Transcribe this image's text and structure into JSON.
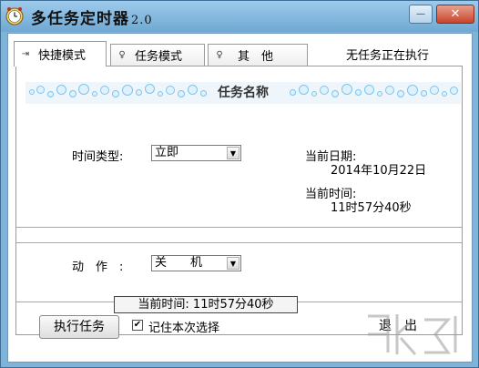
{
  "window": {
    "title": "多任务定时器",
    "version": "2.0",
    "minimize_glyph": "—",
    "close_glyph": "✕"
  },
  "tabs": [
    {
      "label": "快捷模式",
      "icon": "tab-icon-arrow",
      "glyph": "⇥",
      "active": true
    },
    {
      "label": "任务模式",
      "icon": "tab-icon-pin",
      "glyph": "♀",
      "active": false
    },
    {
      "label": "其　他",
      "icon": "tab-icon-pin",
      "glyph": "♀",
      "active": false
    }
  ],
  "status_text": "无任务正在执行",
  "banner_title": "任务名称",
  "time_type": {
    "label": "时间类型:",
    "value": "立即"
  },
  "current_date": {
    "label": "当前日期:",
    "value": "2014年10月22日"
  },
  "current_time": {
    "label": "当前时间:",
    "value": "11时57分40秒"
  },
  "action": {
    "label": "动　作　:",
    "value": "关　　机"
  },
  "bottom_status": "当前时间: 11时57分40秒",
  "buttons": {
    "execute": "执行任务",
    "exit": "退　出"
  },
  "remember": {
    "label": "记住本次选择",
    "checked": true,
    "check_glyph": "✔"
  },
  "combo_arrow": "▼",
  "colors": {
    "title_bar": "#7fb3d8",
    "banner_bubble": "#7fc4ec",
    "close_button": "#c8452c"
  }
}
